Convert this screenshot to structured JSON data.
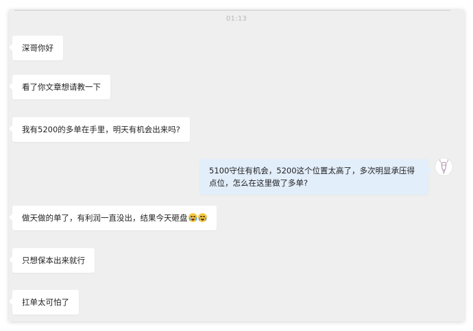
{
  "chat": {
    "timestamp": "01:13",
    "messages": [
      {
        "side": "left",
        "text": "深哥你好"
      },
      {
        "side": "left",
        "text": "看了你文章想请教一下"
      },
      {
        "side": "left",
        "text": "我有5200的多单在手里，明天有机会出来吗?"
      },
      {
        "side": "right",
        "text": "5100守住有机会，5200这个位置太高了，多次明显承压得点位，怎么在这里做了多单?"
      },
      {
        "side": "left",
        "text": "做天做的单了，有利润一直没出，结果今天砸盘",
        "emojis": [
          "crying-face-emoji",
          "crying-face-emoji"
        ]
      },
      {
        "side": "left",
        "text": "只想保本出来就行"
      },
      {
        "side": "left",
        "text": "扛单太可怕了"
      }
    ]
  },
  "colors": {
    "window_bg": "#efefef",
    "left_bubble": "#ffffff",
    "right_bubble": "#e3eefb",
    "timestamp": "#b7b7b7"
  }
}
